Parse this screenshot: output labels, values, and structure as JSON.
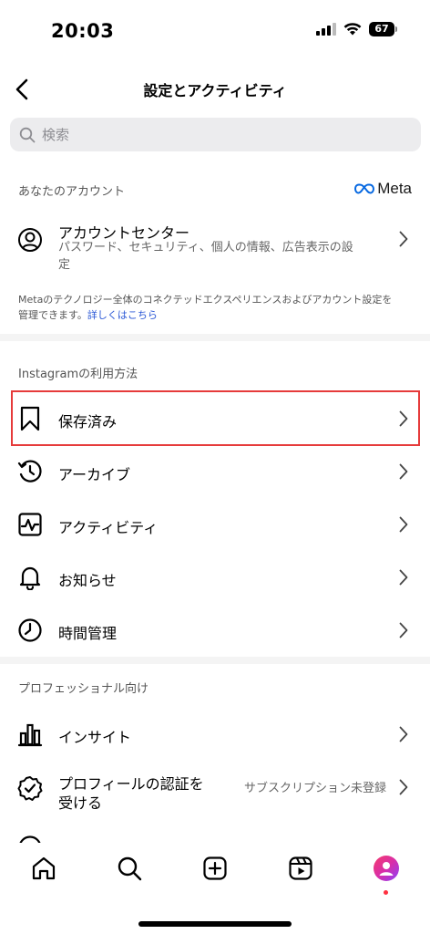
{
  "status": {
    "time": "20:03",
    "battery": "67"
  },
  "nav": {
    "title": "設定とアクティビティ"
  },
  "search": {
    "placeholder": "検索"
  },
  "your_account": {
    "header": "あなたのアカウント",
    "meta_label": "Meta",
    "account_center": {
      "label": "アカウントセンター",
      "subtitle_line1": "パスワード、セキュリティ、個人の情報、広告表示の設",
      "subtitle_line2": "定"
    },
    "footnote_line1": "Metaのテクノロジー全体のコネクテッドエクスペリエンスおよびアカウント設定を",
    "footnote_line2": "管理できます。",
    "footnote_link": "詳しくはこちら"
  },
  "how_you_use": {
    "header": "Instagramの利用方法",
    "items": [
      {
        "label": "保存済み",
        "icon": "bookmark-icon"
      },
      {
        "label": "アーカイブ",
        "icon": "archive-icon"
      },
      {
        "label": "アクティビティ",
        "icon": "activity-icon"
      },
      {
        "label": "お知らせ",
        "icon": "bell-icon"
      },
      {
        "label": "時間管理",
        "icon": "clock-icon"
      }
    ]
  },
  "professional": {
    "header": "プロフェッショナル向け",
    "insights": {
      "label": "インサイト",
      "icon": "insights-icon"
    },
    "verification": {
      "label_line1": "プロフィールの認証を",
      "label_line2": "受ける",
      "value": "サブスクリプション未登録",
      "icon": "verified-badge-icon"
    }
  },
  "tabs": [
    "home",
    "search",
    "create",
    "reels",
    "profile"
  ],
  "colors": {
    "highlight": "#e63b3b",
    "link": "#2b58d6",
    "meta_blue": "#0668e1"
  }
}
